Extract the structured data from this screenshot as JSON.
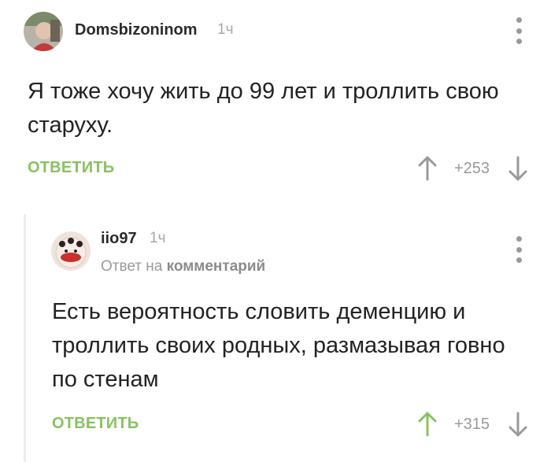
{
  "comments": [
    {
      "username": "Domsbizoninom",
      "time": "1ч",
      "text": "Я тоже хочу жить до 99 лет и троллить свою старуху.",
      "reply_label": "ОТВЕТИТЬ",
      "score": "+253",
      "upvote_color": "#9a9a9a",
      "avatar_icon": "user-avatar"
    },
    {
      "username": "iio97",
      "time": "1ч",
      "reply_prefix": "Ответ на",
      "reply_target": "комментарий",
      "text": "Есть вероятность словить деменцию и троллить своих родных, размазывая говно по стенам",
      "reply_label": "ОТВЕТИТЬ",
      "score": "+315",
      "upvote_color": "#88c25e",
      "avatar_icon": "user-avatar"
    }
  ],
  "colors": {
    "accent_green": "#88c25e",
    "muted_gray": "#9a9a9a",
    "text": "#222222"
  }
}
